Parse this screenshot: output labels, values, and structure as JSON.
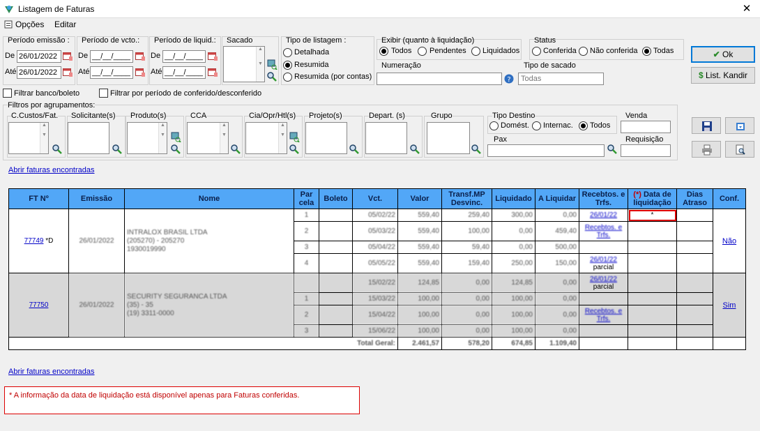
{
  "window": {
    "title": "Listagem de Faturas",
    "close": "✕"
  },
  "menu": {
    "opcoes": "Opções",
    "editar": "Editar"
  },
  "filters": {
    "periodo_emissao": {
      "label": "Período emissão :",
      "de_label": "De",
      "ate_label": "Até",
      "de": "26/01/2022",
      "ate": "26/01/2022"
    },
    "periodo_vcto": {
      "label": "Período de vcto.:",
      "de_label": "De",
      "ate_label": "Até",
      "de": "__/__/____",
      "ate": "__/__/____"
    },
    "periodo_liquid": {
      "label": "Período de liquid.:",
      "de_label": "De",
      "ate_label": "Até",
      "de": "__/__/____",
      "ate": "__/__/____"
    },
    "sacado": {
      "label": "Sacado"
    },
    "tipo_listagem": {
      "label": "Tipo de listagem :",
      "options": [
        "Detalhada",
        "Resumida",
        "Resumida (por contas)"
      ],
      "selected": "Resumida"
    },
    "exibir": {
      "label": "Exibir (quanto à liquidação)",
      "options": [
        "Todos",
        "Pendentes",
        "Liquidados"
      ],
      "selected": "Todos"
    },
    "status": {
      "label": "Status",
      "options": [
        "Conferida",
        "Não conferida",
        "Todas"
      ],
      "selected": "Todas"
    },
    "numeracao": {
      "label": "Numeração",
      "value": ""
    },
    "tipo_sacado": {
      "label": "Tipo de sacado",
      "value": "Todas"
    },
    "filtrar_banco": "Filtrar banco/boleto",
    "filtrar_conferido": "Filtrar por período de conferido/desconferido",
    "agrupamentos": {
      "label": "Filtros por agrupamentos:",
      "groups": [
        "C.Custos/Fat.",
        "Solicitante(s)",
        "Produto(s)",
        "CCA",
        "Cia/Opr/Htl(s)",
        "Projeto(s)",
        "Depart. (s)",
        "Grupo"
      ]
    },
    "tipo_destino": {
      "label": "Tipo Destino",
      "options": [
        "Domést.",
        "Internac.",
        "Todos"
      ],
      "selected": "Todos"
    },
    "pax": {
      "label": "Pax",
      "value": ""
    },
    "venda": {
      "label": "Venda",
      "value": ""
    },
    "requisicao": {
      "label": "Requisição",
      "value": ""
    }
  },
  "buttons": {
    "ok": "Ok",
    "list_kandir": "List. Kandir"
  },
  "links": {
    "abrir_top": "Abrir faturas encontradas",
    "abrir_bottom": "Abrir faturas encontradas"
  },
  "grid": {
    "headers": [
      "FT Nº",
      "Emissão",
      "Nome",
      "Par cela",
      "Boleto",
      "Vct.",
      "Valor",
      "Transf.MP Desvinc.",
      "Liquidado",
      "A Liquidar",
      "Recebtos. e Trfs.",
      "(*) Data de liquidação",
      "Dias Atraso",
      "Conf."
    ],
    "star_header": "(*)",
    "header_dl_rest": "Data de liquidação",
    "groups": [
      {
        "ft": "77749",
        "ft_suffix": "*D",
        "emissao": "26/01/2022",
        "nome1": "INTRALOX BRASIL LTDA",
        "nome2": "(205270) - 205270",
        "nome3": "1930019990",
        "conf": "Não",
        "rows": [
          {
            "parcela": "1",
            "vct": "05/02/22",
            "valor": "559,40",
            "transf": "259,40",
            "liquidado": "300,00",
            "aliquidar": "0,00",
            "receb": "26/01/22",
            "receb_sub": "",
            "dl": "*"
          },
          {
            "parcela": "2",
            "vct": "05/03/22",
            "valor": "559,40",
            "transf": "100,00",
            "liquidado": "0,00",
            "aliquidar": "459,40",
            "receb": "Recebtos. e Trfs.",
            "receb_sub": "",
            "dl": ""
          },
          {
            "parcela": "3",
            "vct": "05/04/22",
            "valor": "559,40",
            "transf": "59,40",
            "liquidado": "0,00",
            "aliquidar": "500,00",
            "receb": "",
            "receb_sub": "",
            "dl": ""
          },
          {
            "parcela": "4",
            "vct": "05/05/22",
            "valor": "559,40",
            "transf": "159,40",
            "liquidado": "250,00",
            "aliquidar": "150,00",
            "receb": "26/01/22",
            "receb_sub": "parcial",
            "dl": ""
          }
        ]
      },
      {
        "ft": "77750",
        "ft_suffix": "",
        "emissao": "26/01/2022",
        "nome1": "SECURITY SEGURANCA LTDA",
        "nome2": "(35) - 35",
        "nome3": "(19) 3311-0000",
        "conf": "Sim",
        "rows": [
          {
            "parcela": "",
            "vct": "15/02/22",
            "valor": "124,85",
            "transf": "0,00",
            "liquidado": "124,85",
            "aliquidar": "0,00",
            "receb": "26/01/22",
            "receb_sub": "parcial",
            "dl": ""
          },
          {
            "parcela": "1",
            "vct": "15/03/22",
            "valor": "100,00",
            "transf": "0,00",
            "liquidado": "100,00",
            "aliquidar": "0,00",
            "receb": "",
            "receb_sub": "",
            "dl": ""
          },
          {
            "parcela": "2",
            "vct": "15/04/22",
            "valor": "100,00",
            "transf": "0,00",
            "liquidado": "100,00",
            "aliquidar": "0,00",
            "receb": "Recebtos. e Trfs.",
            "receb_sub": "",
            "dl": ""
          },
          {
            "parcela": "3",
            "vct": "15/06/22",
            "valor": "100,00",
            "transf": "0,00",
            "liquidado": "100,00",
            "aliquidar": "0,00",
            "receb": "",
            "receb_sub": "",
            "dl": ""
          }
        ]
      }
    ],
    "total": {
      "label": "Total Geral:",
      "valor": "2.461,57",
      "transf": "578,20",
      "liquidado": "674,85",
      "aliquidar": "1.109,40"
    }
  },
  "note": "* A informação da data de liquidação está disponível apenas para Faturas conferidas.",
  "colors": {
    "header": "#52a7f7",
    "link": "#0000c8",
    "note_border": "#dd0000"
  }
}
